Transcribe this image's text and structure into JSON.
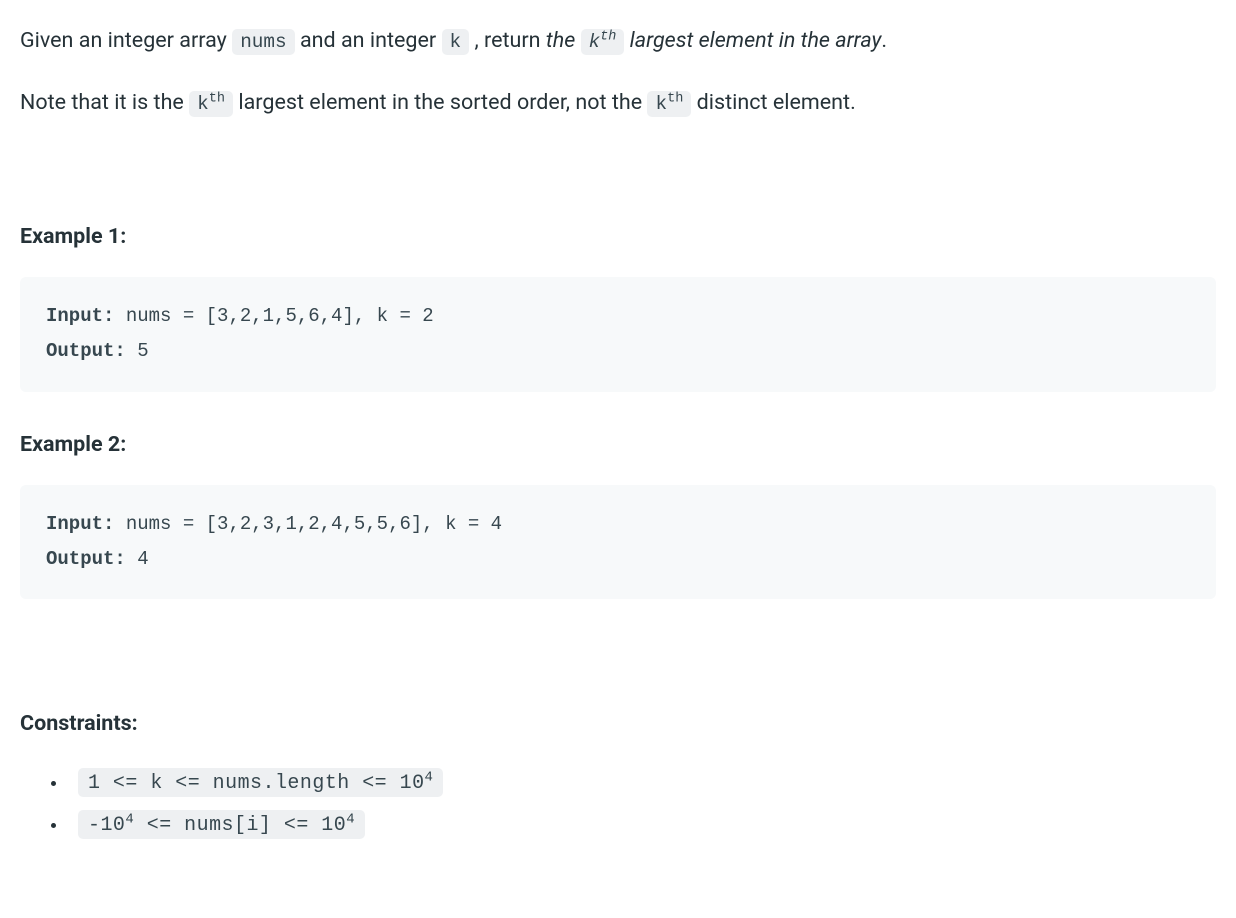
{
  "intro": {
    "t1": "Given an integer array ",
    "code_nums": "nums",
    "t2": " and an integer ",
    "code_k": "k",
    "t3": " , return ",
    "italic_the": "the ",
    "code_kth": "k",
    "sup_th": "th",
    "italic_rest": " largest element in the array",
    "period": "."
  },
  "note": {
    "t1": "Note that it is the ",
    "code_kth": "k",
    "sup_th": "th",
    "t2": " largest element in the sorted order, not the ",
    "code_kth2": "k",
    "sup_th2": "th",
    "t3": " distinct element."
  },
  "example1": {
    "heading": "Example 1:",
    "input_label": "Input:",
    "input_value": " nums = [3,2,1,5,6,4], k = 2",
    "output_label": "Output:",
    "output_value": " 5"
  },
  "example2": {
    "heading": "Example 2:",
    "input_label": "Input:",
    "input_value": " nums = [3,2,3,1,2,4,5,5,6], k = 4",
    "output_label": "Output:",
    "output_value": " 4"
  },
  "constraints": {
    "heading": "Constraints:",
    "c1": {
      "a": "1 <= k <= nums.length <= 10",
      "sup": "4"
    },
    "c2": {
      "a": "-10",
      "sup1": "4",
      "b": " <= nums[i] <= 10",
      "sup2": "4"
    }
  }
}
